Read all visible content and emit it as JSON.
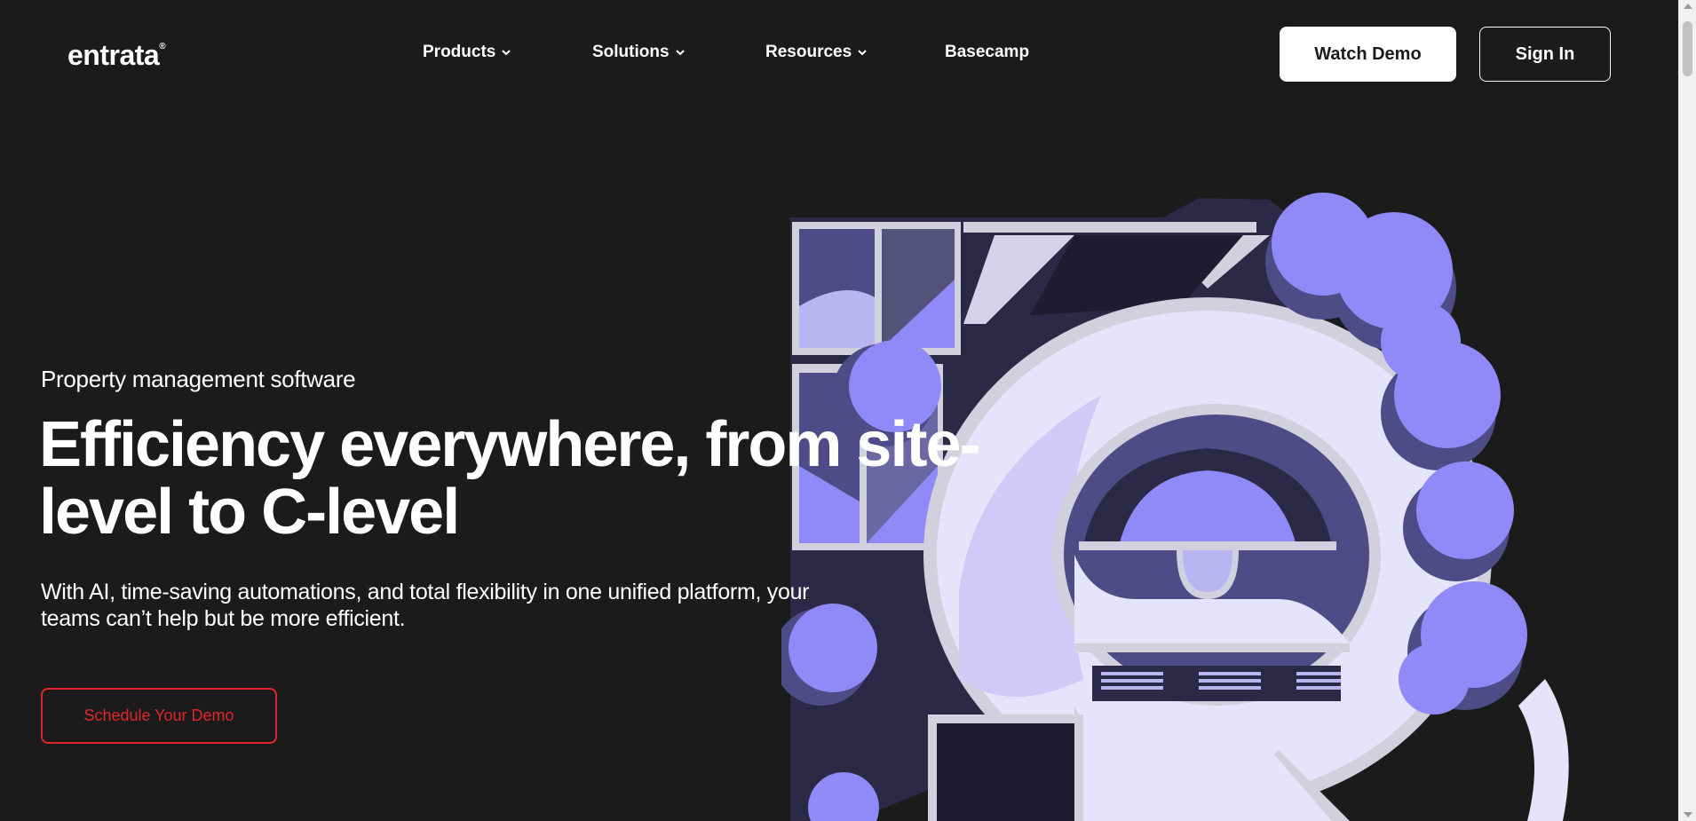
{
  "header": {
    "logo": "entrata",
    "logo_mark": "®",
    "nav": {
      "products": "Products",
      "solutions": "Solutions",
      "resources": "Resources",
      "basecamp": "Basecamp"
    },
    "watch_demo": "Watch Demo",
    "sign_in": "Sign In"
  },
  "hero": {
    "eyebrow": "Property management software",
    "headline_line1": "Efficiency everywhere, from site-",
    "headline_line2": "level to C-level",
    "subtext_line1": "With AI, time-saving automations, and total flexibility in one unified platform, your",
    "subtext_line2": "teams can’t help but be more efficient.",
    "cta": "Schedule Your Demo"
  },
  "illustration": {
    "subject": "isometric building shaped like the Entrata logo surrounded by trees",
    "colors": {
      "lavender": "#e6e4fb",
      "light_violet": "#b9b5f2",
      "violet": "#8f8af7",
      "mid_purple": "#4f4b86",
      "dark_purple": "#2b2945",
      "outline": "#d2d0dd"
    }
  },
  "colors": {
    "background": "#1b1b1b",
    "text": "#ffffff",
    "cta_red": "#e0262b",
    "button_white": "#ffffff"
  }
}
